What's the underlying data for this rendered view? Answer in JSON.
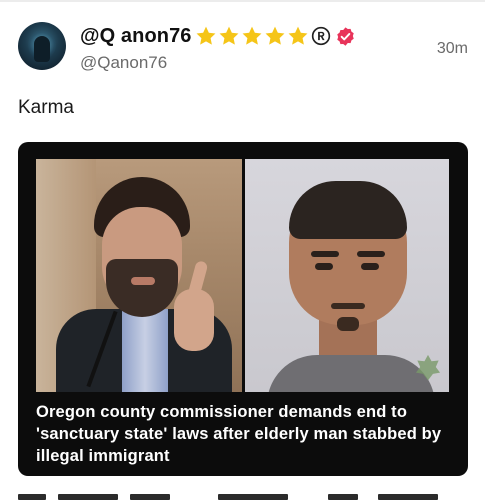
{
  "post": {
    "author": {
      "display_name": "@Q anon76",
      "handle": "@Qanon76",
      "star_count": 5,
      "star_icon": "star-icon",
      "registered_icon": "registered-icon",
      "verified_icon": "verified-badge-icon"
    },
    "timestamp": "30m",
    "text": "Karma",
    "media": {
      "headline": "Oregon county commissioner demands end to 'sanctuary state' laws after elderly man stabbed by illegal immigrant"
    }
  },
  "colors": {
    "star": "#f5c518",
    "verified_badge": "#e8345a",
    "card_background": "#0c0c0c",
    "secondary_text": "#6a6a6a"
  }
}
